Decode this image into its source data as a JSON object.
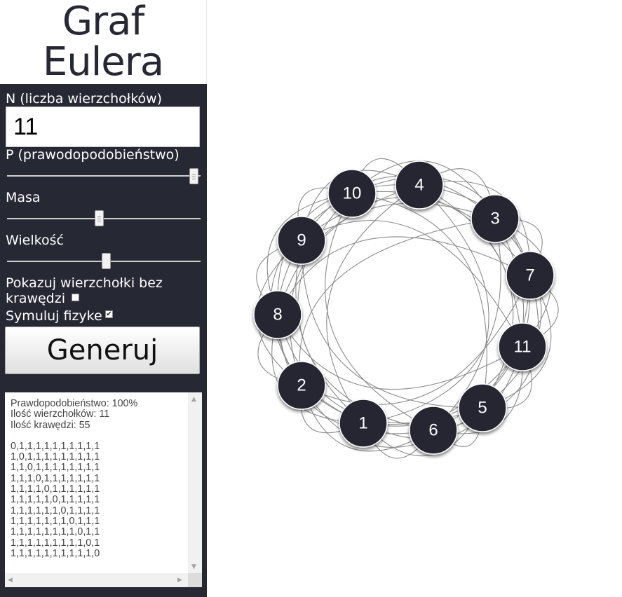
{
  "title_line1": "Graf",
  "title_line2": "Eulera",
  "controls": {
    "n_label": "N (liczba wierzchołków)",
    "n_value": "11",
    "p_label": "P (prawodopodobieństwo)",
    "p_value": 1.0,
    "mass_label": "Masa",
    "mass_value": 0.48,
    "size_label": "Wielkość",
    "size_value": 0.52,
    "show_isolated_label_1": "Pokazuj wierzchołki bez",
    "show_isolated_label_2": "krawędzi",
    "show_isolated_checked": false,
    "simulate_label": "Symuluj fizyke",
    "simulate_checked": true,
    "generate_label": "Generuj"
  },
  "output": {
    "probability": "Prawdopodobieństwo: 100%",
    "vertex_count": "Ilość wierzchołków: 11",
    "edge_count": "Ilość krawędzi: 55",
    "matrix": [
      "0,1,1,1,1,1,1,1,1,1,1",
      "1,0,1,1,1,1,1,1,1,1,1",
      "1,1,0,1,1,1,1,1,1,1,1",
      "1,1,1,0,1,1,1,1,1,1,1",
      "1,1,1,1,0,1,1,1,1,1,1",
      "1,1,1,1,1,0,1,1,1,1,1",
      "1,1,1,1,1,1,0,1,1,1,1",
      "1,1,1,1,1,1,1,0,1,1,1",
      "1,1,1,1,1,1,1,1,0,1,1",
      "1,1,1,1,1,1,1,1,1,0,1",
      "1,1,1,1,1,1,1,1,1,1,0"
    ]
  },
  "graph": {
    "nodes": [
      "10",
      "4",
      "3",
      "9",
      "7",
      "8",
      "11",
      "2",
      "5",
      "1",
      "6"
    ],
    "node_color": "#262833",
    "edge_color": "#8a8a8a"
  }
}
